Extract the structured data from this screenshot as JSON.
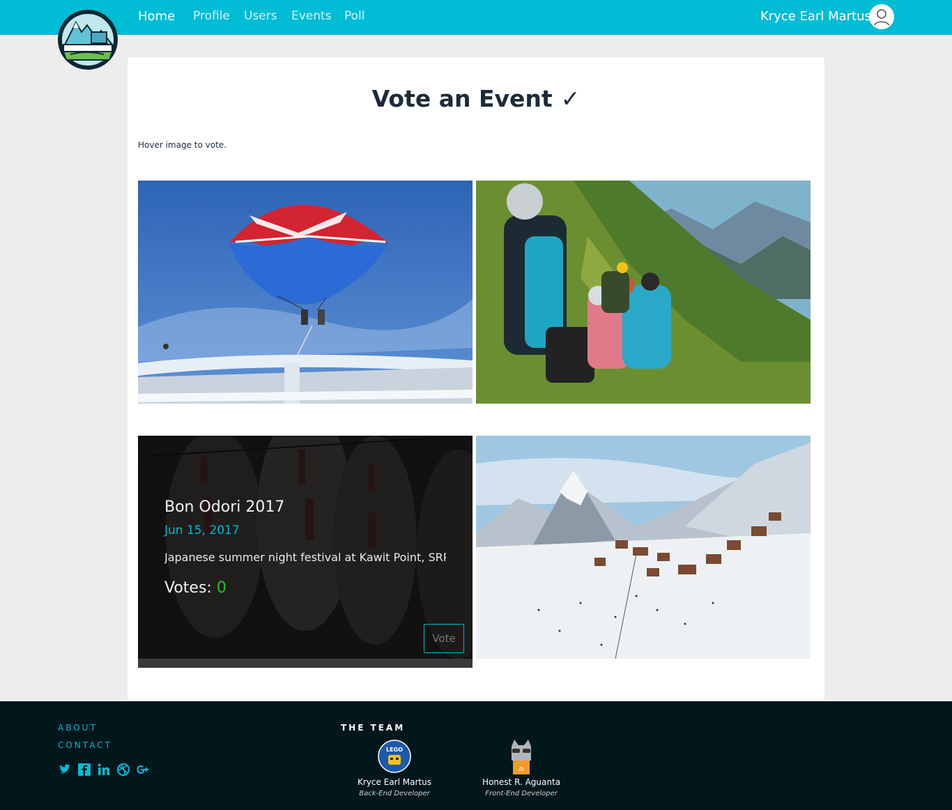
{
  "nav": {
    "items": [
      {
        "label": "Home",
        "active": true
      },
      {
        "label": "Profile"
      },
      {
        "label": "Users"
      },
      {
        "label": "Events"
      },
      {
        "label": "Poll"
      }
    ],
    "user_name": "Kryce Earl Martus"
  },
  "page": {
    "title": "Vote an Event",
    "title_icon": "✓",
    "hint": "Hover image to vote."
  },
  "events": [
    {
      "image_icon": "parasail-photo"
    },
    {
      "image_icon": "hikers-photo"
    },
    {
      "image_icon": "lanterns-photo",
      "title": "Bon Odori 2017",
      "date": "Jun 15, 2017",
      "description": "Japanese summer night festival at Kawit Point, SRP",
      "votes_label": "Votes:",
      "votes": "0",
      "vote_button": "Vote"
    },
    {
      "image_icon": "ski-village-photo"
    }
  ],
  "footer": {
    "links": [
      "ABOUT",
      "CONTACT"
    ],
    "social_icons": [
      "twitter-icon",
      "facebook-icon",
      "linkedin-icon",
      "dribbble-icon",
      "google-plus-icon"
    ],
    "team_title": "THE TEAM",
    "team": [
      {
        "name": "Kryce Earl Martus",
        "role": "Back-End Developer",
        "badge_text": "LEGO"
      },
      {
        "name": "Honest R. Aguanta",
        "role": "Front-End Developer",
        "badge_text": "Ai"
      }
    ]
  },
  "colors": {
    "accent": "#00bcd4",
    "title": "#1c2b3a",
    "footer_bg": "#02171b",
    "vote_count": "#22c422"
  }
}
